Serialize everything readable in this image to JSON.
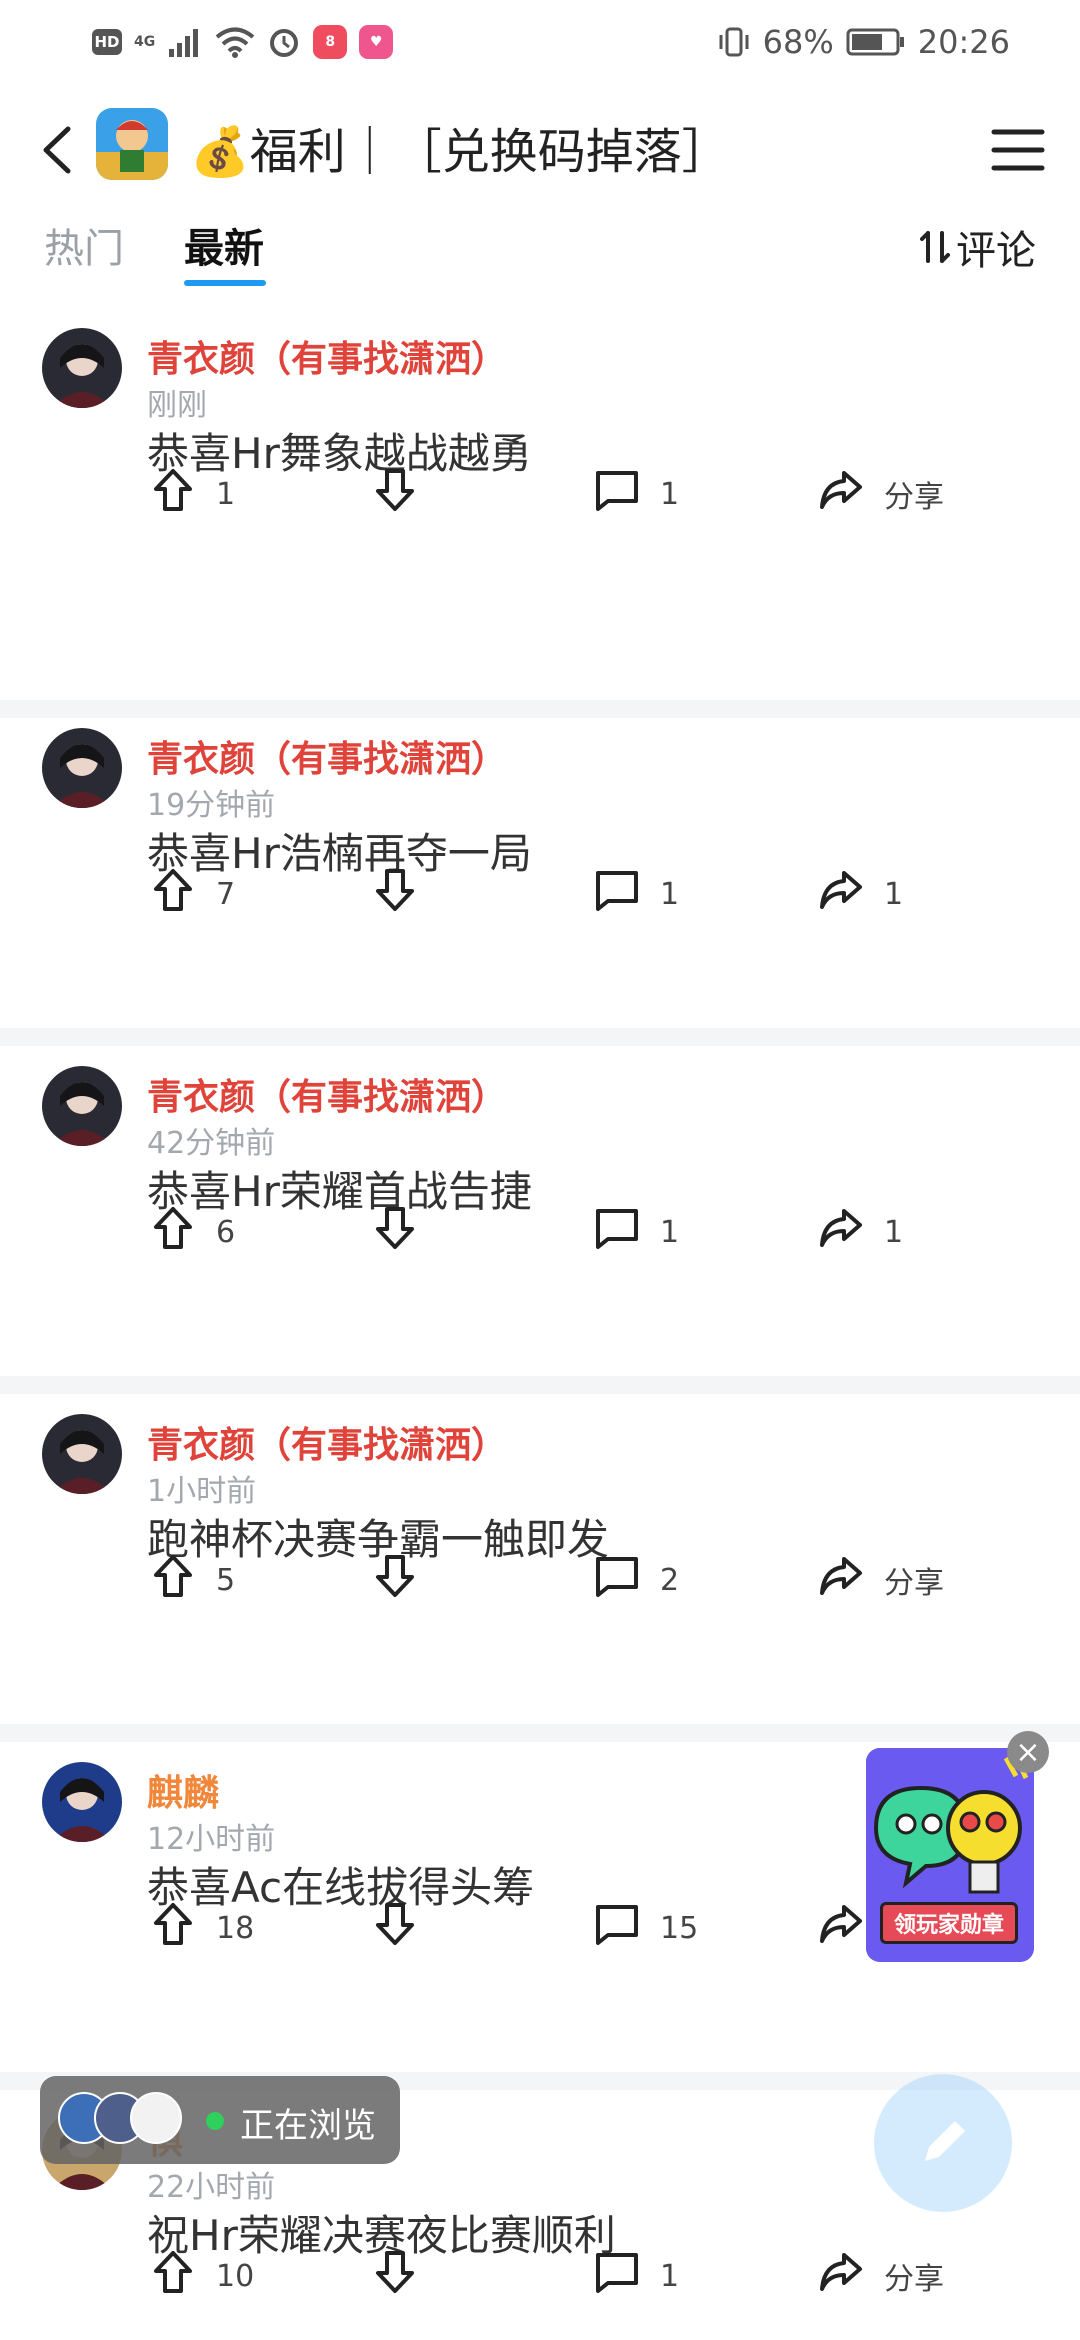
{
  "status_bar": {
    "hd": "HD",
    "net": "4G",
    "battery": "68%",
    "time": "20:26"
  },
  "header": {
    "title": "💰福利｜［兑换码掉落］"
  },
  "tabs": {
    "hot": "热门",
    "latest": "最新",
    "sort": "评论"
  },
  "posts": [
    {
      "user": "青衣颜（有事找潇洒）",
      "user_color": "#e0433a",
      "time": "刚刚",
      "content": "恭喜Hr舞象越战越勇",
      "upvotes": "1",
      "comments": "1",
      "share": "分享"
    },
    {
      "user": "青衣颜（有事找潇洒）",
      "user_color": "#e0433a",
      "time": "19分钟前",
      "content": "恭喜Hr浩楠再夺一局",
      "upvotes": "7",
      "comments": "1",
      "share": "1"
    },
    {
      "user": "青衣颜（有事找潇洒）",
      "user_color": "#e0433a",
      "time": "42分钟前",
      "content": "恭喜Hr荣耀首战告捷",
      "upvotes": "6",
      "comments": "1",
      "share": "1"
    },
    {
      "user": "青衣颜（有事找潇洒）",
      "user_color": "#e0433a",
      "time": "1小时前",
      "content": "跑神杯决赛争霸一触即发",
      "upvotes": "5",
      "comments": "2",
      "share": "分享"
    },
    {
      "user": "麒麟",
      "user_color": "#f0873a",
      "time": "12小时前",
      "content": "恭喜Ac在线拔得头筹",
      "upvotes": "18",
      "comments": "15",
      "share": "分享"
    },
    {
      "user": "惧",
      "user_color": "#f0873a",
      "time": "22小时前",
      "content": "祝Hr荣耀决赛夜比赛顺利",
      "upvotes": "10",
      "comments": "1",
      "share": "分享"
    }
  ],
  "badge_ad": {
    "label": "领玩家勋章"
  },
  "browsing": {
    "text": "正在浏览"
  },
  "colors": {
    "accent": "#1e9bf0",
    "divider": "#f4f5f7"
  },
  "icons": [
    "back-icon",
    "menu-icon",
    "sort-icon",
    "upvote-icon",
    "downvote-icon",
    "comment-icon",
    "share-icon",
    "close-icon",
    "pen-icon"
  ]
}
